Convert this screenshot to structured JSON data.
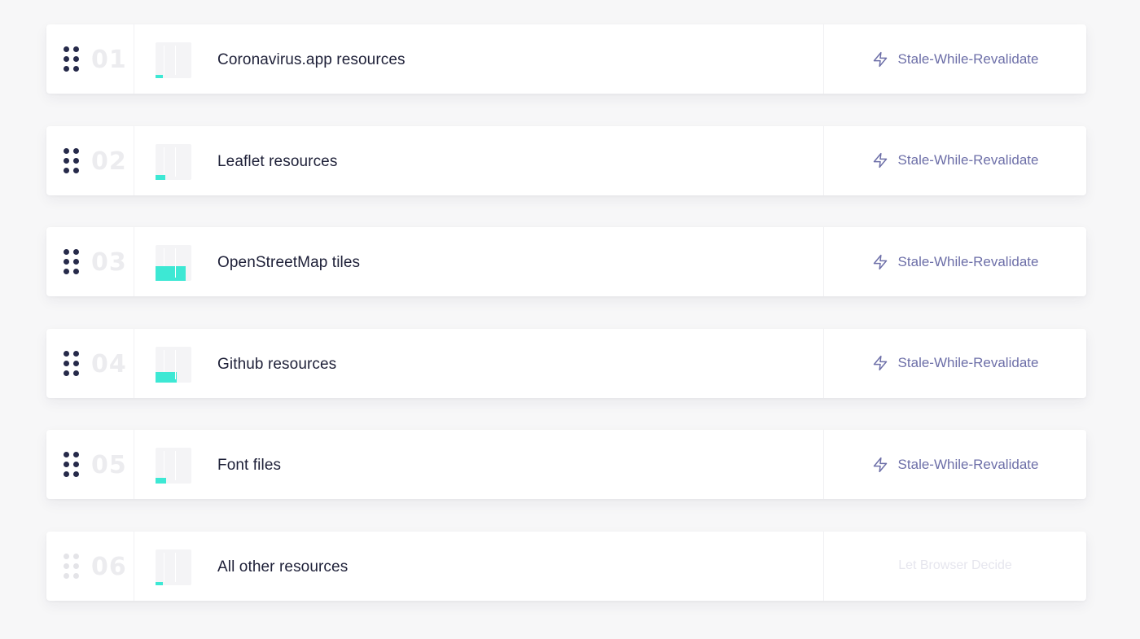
{
  "rows": [
    {
      "number": "01",
      "label": "Coronavirus.app resources",
      "strategy": "Stale-While-Revalidate",
      "strategy_icon": "lightning-icon",
      "usage": 0.1,
      "muted": false
    },
    {
      "number": "02",
      "label": "Leaflet resources",
      "strategy": "Stale-While-Revalidate",
      "strategy_icon": "lightning-icon",
      "usage": 0.14,
      "muted": false
    },
    {
      "number": "03",
      "label": "OpenStreetMap tiles",
      "strategy": "Stale-While-Revalidate",
      "strategy_icon": "lightning-icon",
      "usage": 0.42,
      "muted": false
    },
    {
      "number": "04",
      "label": "Github resources",
      "strategy": "Stale-While-Revalidate",
      "strategy_icon": "lightning-icon",
      "usage": 0.3,
      "muted": false
    },
    {
      "number": "05",
      "label": "Font files",
      "strategy": "Stale-While-Revalidate",
      "strategy_icon": "lightning-icon",
      "usage": 0.15,
      "muted": false
    },
    {
      "number": "06",
      "label": "All other resources",
      "strategy": "Let Browser Decide",
      "strategy_icon": "",
      "usage": 0.1,
      "muted": true
    }
  ],
  "colors": {
    "accent": "#3de8d4",
    "strategy_text": "#6d6fa8",
    "label_text": "#1e2038",
    "handle": "#262a4a"
  }
}
